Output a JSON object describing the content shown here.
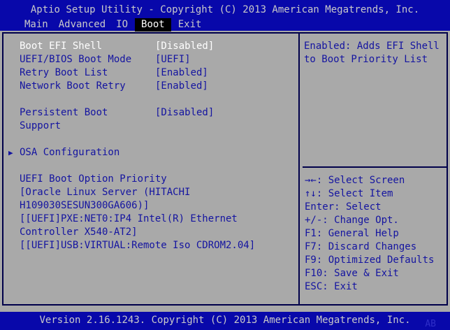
{
  "title_bar": {
    "title": "Aptio Setup Utility - Copyright (C) 2013 American Megatrends, Inc."
  },
  "menu": {
    "items": [
      {
        "label": "Main",
        "selected": false
      },
      {
        "label": "Advanced",
        "selected": false
      },
      {
        "label": "IO",
        "selected": false
      },
      {
        "label": "Boot",
        "selected": true
      },
      {
        "label": "Exit",
        "selected": false
      }
    ]
  },
  "left_panel": {
    "setting_groups": [
      [
        {
          "label": "Boot EFI Shell",
          "value": "[Disabled]",
          "selected": true
        },
        {
          "label": "UEFI/BIOS Boot Mode",
          "value": "[UEFI]",
          "selected": false
        },
        {
          "label": "Retry Boot List",
          "value": "[Enabled]",
          "selected": false
        },
        {
          "label": "Network Boot Retry",
          "value": "[Enabled]",
          "selected": false
        }
      ],
      [
        {
          "label": "Persistent Boot Support",
          "value": "[Disabled]",
          "selected": false
        }
      ]
    ],
    "submenu": {
      "arrow_icon": "▶",
      "label": "OSA Configuration"
    },
    "boot_priority": {
      "heading": "UEFI Boot Option Priority",
      "entries": [
        "[Oracle Linux Server (HITACHI H109030SESUN300GA606)]",
        "[[UEFI]PXE:NET0:IP4 Intel(R) Ethernet Controller X540-AT2]",
        "[[UEFI]USB:VIRTUAL:Remote Iso CDROM2.04]"
      ]
    }
  },
  "right_panel": {
    "help_text": "Enabled: Adds EFI Shell to Boot Priority List",
    "keys": [
      {
        "key": "→←",
        "action": "Select Screen"
      },
      {
        "key": "↑↓",
        "action": "Select Item"
      },
      {
        "key": "Enter",
        "action": "Select"
      },
      {
        "key": "+/-",
        "action": "Change Opt."
      },
      {
        "key": "F1",
        "action": "General Help"
      },
      {
        "key": "F7",
        "action": "Discard Changes"
      },
      {
        "key": "F9",
        "action": "Optimized Defaults"
      },
      {
        "key": "F10",
        "action": "Save & Exit"
      },
      {
        "key": "ESC",
        "action": "Exit"
      }
    ]
  },
  "footer": {
    "version_text": "Version 2.16.1243. Copyright (C) 2013 American Megatrends, Inc.",
    "watermark": "AB"
  },
  "colors": {
    "bar_blue": "#0808aa",
    "panel_gray": "#a9a9a9",
    "text_blue": "#1414a0",
    "light_text": "#c9c9c9",
    "border_navy": "#00004a",
    "tab_bg": "#000000",
    "white": "#ffffff",
    "watermark_blue": "#2e2ec8"
  }
}
